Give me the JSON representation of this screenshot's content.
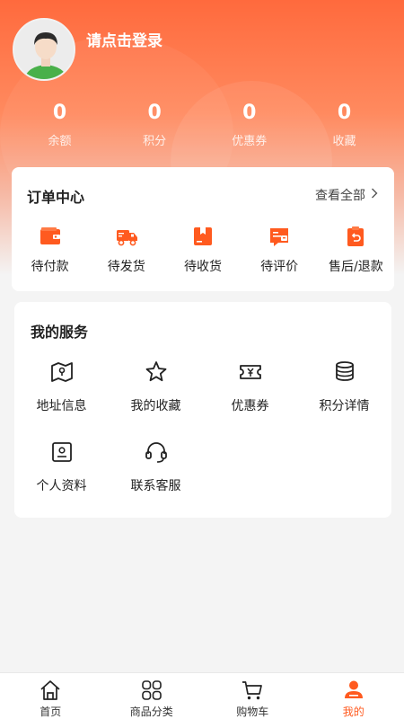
{
  "user": {
    "login_prompt": "请点击登录"
  },
  "stats": [
    {
      "value": "0",
      "label": "余额"
    },
    {
      "value": "0",
      "label": "积分"
    },
    {
      "value": "0",
      "label": "优惠券"
    },
    {
      "value": "0",
      "label": "收藏"
    }
  ],
  "orders": {
    "title": "订单中心",
    "view_all": "查看全部",
    "items": [
      {
        "label": "待付款",
        "icon": "wallet-icon"
      },
      {
        "label": "待发货",
        "icon": "truck-icon"
      },
      {
        "label": "待收货",
        "icon": "package-icon"
      },
      {
        "label": "待评价",
        "icon": "review-icon"
      },
      {
        "label": "售后/退款",
        "icon": "refund-icon"
      }
    ]
  },
  "services": {
    "title": "我的服务",
    "items": [
      {
        "label": "地址信息",
        "icon": "map-icon"
      },
      {
        "label": "我的收藏",
        "icon": "star-icon"
      },
      {
        "label": "优惠券",
        "icon": "coupon-icon"
      },
      {
        "label": "积分详情",
        "icon": "coins-icon"
      },
      {
        "label": "个人资料",
        "icon": "profile-icon"
      },
      {
        "label": "联系客服",
        "icon": "headset-icon"
      }
    ]
  },
  "tabbar": [
    {
      "label": "首页",
      "icon": "home-icon",
      "active": false
    },
    {
      "label": "商品分类",
      "icon": "grid-icon",
      "active": false
    },
    {
      "label": "购物车",
      "icon": "cart-icon",
      "active": false
    },
    {
      "label": "我的",
      "icon": "user-icon",
      "active": true
    }
  ],
  "colors": {
    "accent": "#ff5a1f",
    "header_start": "#ff6a3d",
    "background": "#f4f4f4"
  }
}
